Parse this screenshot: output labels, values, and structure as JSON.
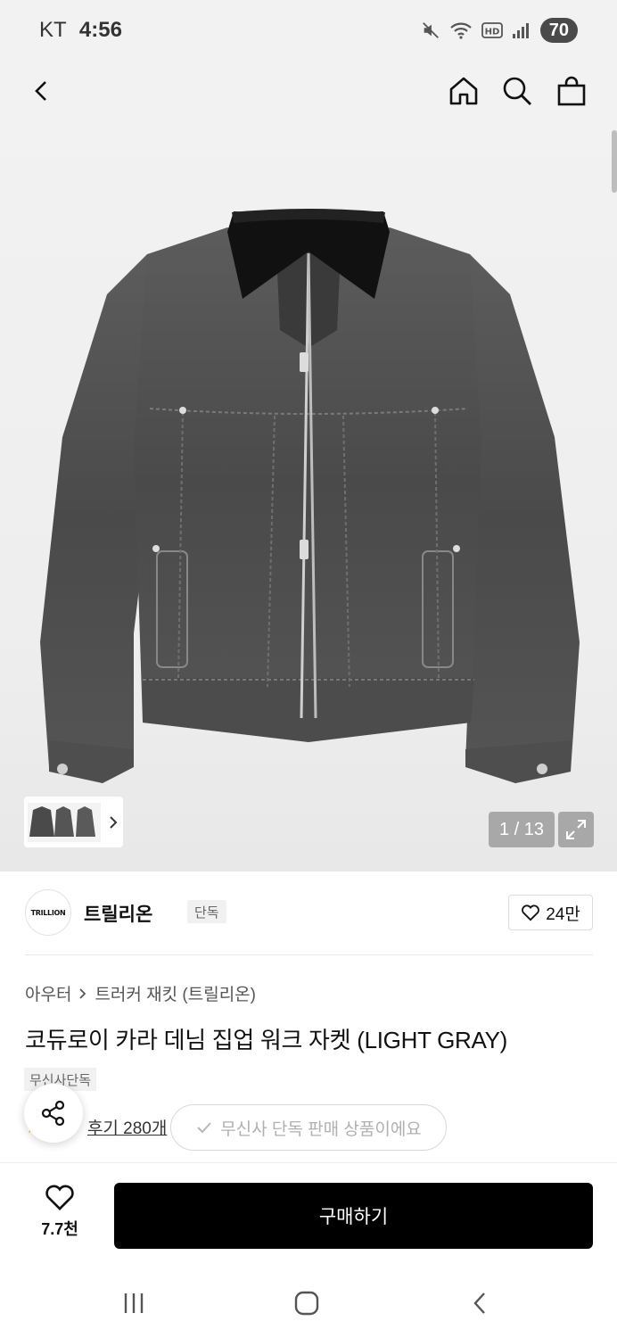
{
  "status_bar": {
    "carrier": "KT",
    "time": "4:56",
    "battery": "70",
    "icons": [
      "mute-icon",
      "wifi-icon",
      "hd-icon",
      "signal-icon",
      "battery-icon"
    ]
  },
  "top_bar": {
    "icons": [
      "back-icon",
      "home-icon",
      "search-icon",
      "shopping-bag-icon"
    ]
  },
  "gallery": {
    "counter": "1 / 13",
    "current_index": 1,
    "total": 13,
    "thumbnail_icon": "chevron-right-icon",
    "expand_icon": "expand-icon"
  },
  "brand": {
    "logo_text": "TRILLION",
    "name": "트릴리온",
    "badge": "단독",
    "likes": "24만"
  },
  "product": {
    "breadcrumb": [
      "아우터",
      "트러커 재킷 (트릴리온)"
    ],
    "title": "코듀로이 카라 데님 집업 워크 자켓 (LIGHT GRAY)",
    "tag": "무신사단독",
    "reviews": "후기 280개"
  },
  "toast": {
    "text": "무신사 단독 판매 상품이에요"
  },
  "bottom_bar": {
    "wish_count": "7.7천",
    "buy_label": "구매하기"
  },
  "colors": {
    "buy_button": "#000000",
    "star": "#f5a623",
    "hero_bg": "#f0f0f0"
  }
}
